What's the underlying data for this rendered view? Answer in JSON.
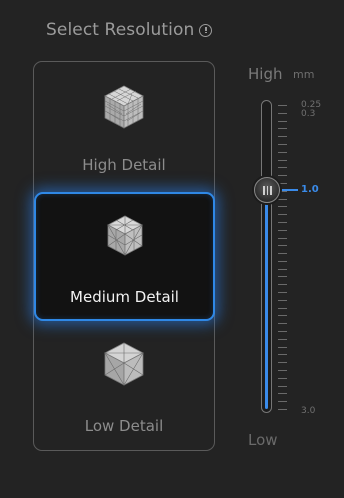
{
  "header": {
    "title": "Select Resolution"
  },
  "options": [
    {
      "label": "High Detail",
      "icon": "high-detail-cube-icon",
      "selected": false
    },
    {
      "label": "Medium Detail",
      "icon": "medium-detail-cube-icon",
      "selected": true
    },
    {
      "label": "Low Detail",
      "icon": "low-detail-cube-icon",
      "selected": false
    }
  ],
  "slider": {
    "top_label": "High",
    "unit": "mm",
    "bottom_label": "Low",
    "value": 1.0,
    "value_label": "1.0",
    "min_label": "0.25",
    "min_label_2": "0.3",
    "max_label": "3.0",
    "min": 0.25,
    "max": 3.0,
    "tick_count": 40,
    "accent_color": "#3a8bea"
  }
}
